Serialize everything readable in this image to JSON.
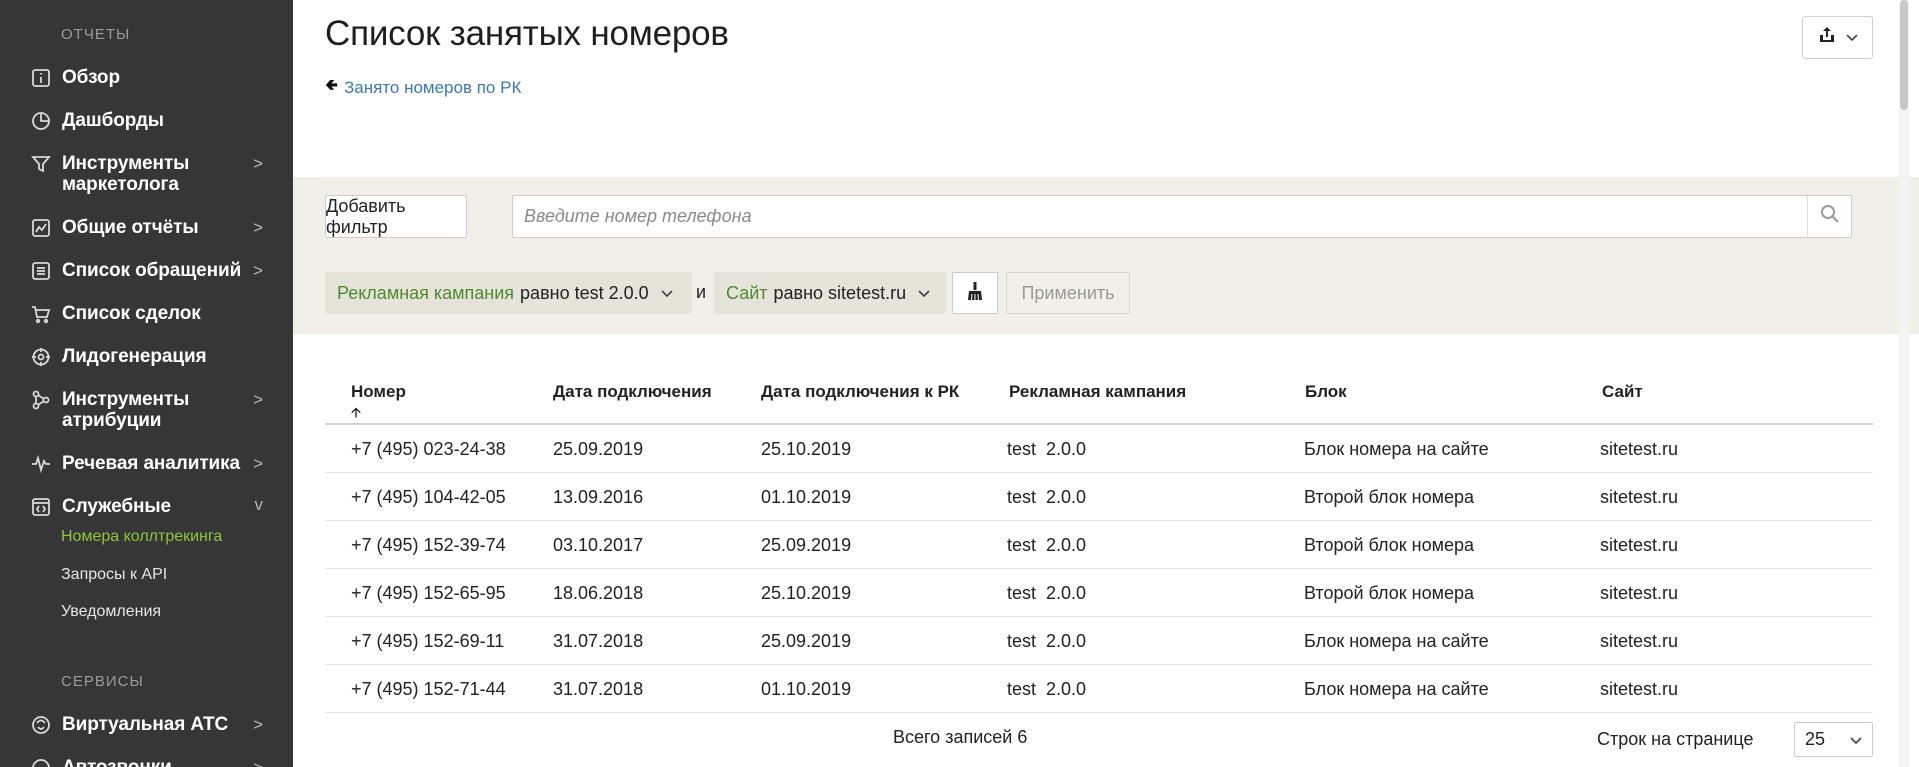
{
  "sidebar": {
    "reports_title": "ОТЧЕТЫ",
    "services_title": "СЕРВИСЫ",
    "items": [
      {
        "label": "Обзор",
        "icon": "info-icon",
        "arrow": ""
      },
      {
        "label": "Дашборды",
        "icon": "pie-icon",
        "arrow": ""
      },
      {
        "label": "Инструменты маркетолога",
        "icon": "filter-icon",
        "arrow": ">"
      },
      {
        "label": "Общие отчёты",
        "icon": "chart-icon",
        "arrow": ">"
      },
      {
        "label": "Список обращений",
        "icon": "list-icon",
        "arrow": ">"
      },
      {
        "label": "Список сделок",
        "icon": "cart-icon",
        "arrow": ""
      },
      {
        "label": "Лидогенерация",
        "icon": "leadgen-icon",
        "arrow": ""
      },
      {
        "label": "Инструменты атрибуции",
        "icon": "attribution-icon",
        "arrow": ">"
      },
      {
        "label": "Речевая аналитика",
        "icon": "waveform-icon",
        "arrow": ">"
      },
      {
        "label": "Служебные",
        "icon": "code-icon",
        "arrow": "v"
      }
    ],
    "subitems": [
      {
        "label": "Номера коллтрекинга",
        "active": true
      },
      {
        "label": "Запросы к API",
        "active": false
      },
      {
        "label": "Уведомления",
        "active": false
      }
    ],
    "service_items": [
      {
        "label": "Виртуальная АТС",
        "icon": "pbx-icon",
        "arrow": ">"
      },
      {
        "label": "Автозвонки",
        "icon": "autocall-icon",
        "arrow": ">"
      }
    ]
  },
  "page": {
    "title": "Список занятых номеров",
    "back_link": "Занято номеров по РК"
  },
  "filters": {
    "add_filter": "Добавить фильтр",
    "search_placeholder": "Введите номер телефона",
    "chip1_key": "Рекламная кампания",
    "chip1_rest": "равно test 2.0.0",
    "conj": "и",
    "chip2_key": "Сайт",
    "chip2_rest": "равно sitetest.ru",
    "apply": "Применить"
  },
  "table": {
    "columns": [
      "Номер",
      "Дата подключения",
      "Дата подключения к РК",
      "Рекламная кампания",
      "Блок",
      "Сайт"
    ],
    "rows": [
      [
        "+7 (495) 023-24-38",
        "25.09.2019",
        "25.10.2019",
        "test  2.0.0",
        "Блок номера на сайте",
        "sitetest.ru"
      ],
      [
        "+7 (495) 104-42-05",
        "13.09.2016",
        "01.10.2019",
        "test  2.0.0",
        "Второй блок номера",
        "sitetest.ru"
      ],
      [
        "+7 (495) 152-39-74",
        "03.10.2017",
        "25.09.2019",
        "test  2.0.0",
        "Второй блок номера",
        "sitetest.ru"
      ],
      [
        "+7 (495) 152-65-95",
        "18.06.2018",
        "25.10.2019",
        "test  2.0.0",
        "Второй блок номера",
        "sitetest.ru"
      ],
      [
        "+7 (495) 152-69-11",
        "31.07.2018",
        "25.09.2019",
        "test  2.0.0",
        "Блок номера на сайте",
        "sitetest.ru"
      ],
      [
        "+7 (495) 152-71-44",
        "31.07.2018",
        "01.10.2019",
        "test  2.0.0",
        "Блок номера на сайте",
        "sitetest.ru"
      ]
    ]
  },
  "footer": {
    "total": "Всего записей 6",
    "per_page_label": "Строк на странице",
    "per_page_value": "25"
  },
  "colors": {
    "sidebar_bg": "#363636",
    "active_green": "#8cc63f",
    "link_blue": "#3b78b8",
    "filter_bg": "#f1efe8"
  }
}
